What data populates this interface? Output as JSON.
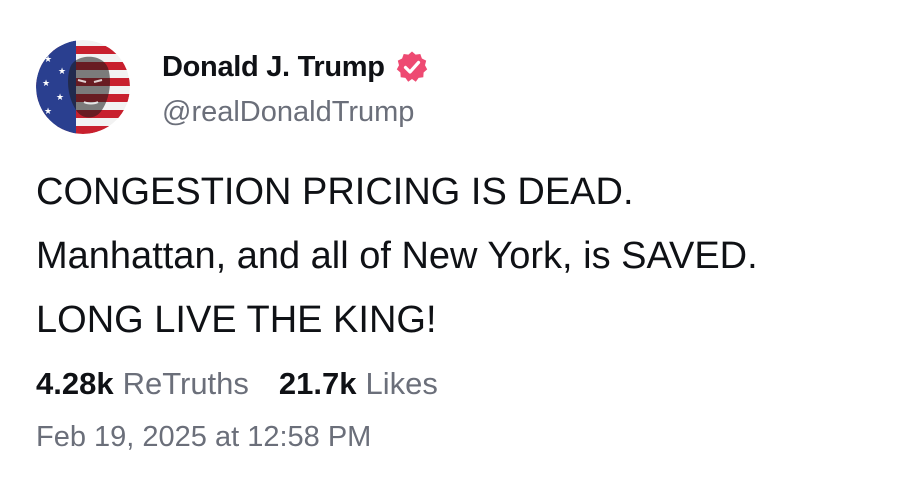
{
  "author": {
    "display_name": "Donald J. Trump",
    "handle": "@realDonaldTrump",
    "verified": true,
    "verified_badge_color": "#ee4a72",
    "avatar_icon": "flag-portrait-avatar"
  },
  "post": {
    "lines": [
      "CONGESTION PRICING IS DEAD.",
      "Manhattan, and all of New York, is SAVED.",
      "LONG LIVE THE KING!"
    ]
  },
  "stats": {
    "retruths_count": "4.28k",
    "retruths_label": "ReTruths",
    "likes_count": "21.7k",
    "likes_label": "Likes"
  },
  "timestamp": "Feb 19, 2025 at 12:58 PM"
}
